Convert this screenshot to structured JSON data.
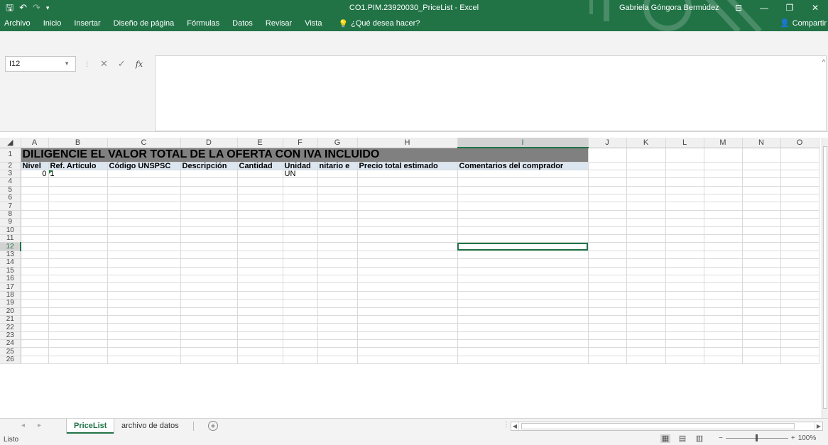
{
  "window": {
    "title": "CO1.PIM.23920030_PriceList - Excel",
    "user": "Gabriela Góngora Bermúdez",
    "controls": [
      "⊟",
      "—",
      "❐",
      "✕"
    ]
  },
  "ribbon": {
    "tabs": [
      "Archivo",
      "Inicio",
      "Insertar",
      "Diseño de página",
      "Fórmulas",
      "Datos",
      "Revisar",
      "Vista"
    ],
    "tell_me": "¿Qué desea hacer?",
    "share": "Compartir"
  },
  "formula_bar": {
    "name_box": "I12",
    "content": ""
  },
  "columns": [
    "A",
    "B",
    "C",
    "D",
    "E",
    "F",
    "G",
    "H",
    "I",
    "J",
    "K",
    "L",
    "M",
    "N",
    "O"
  ],
  "rows": [
    "1",
    "2",
    "3",
    "4",
    "5",
    "6",
    "7",
    "8",
    "9",
    "10",
    "11",
    "12",
    "13",
    "14",
    "15",
    "16",
    "17",
    "18",
    "19",
    "20",
    "21",
    "22",
    "23",
    "24",
    "25",
    "26"
  ],
  "sheet": {
    "title": "DILIGENCIE EL VALOR TOTAL DE LA OFERTA CON IVA INCLUIDO",
    "headers": [
      "Nivel",
      "Ref. Artículo",
      "Código UNSPSC",
      "Descripción",
      "Cantidad",
      "Unidad",
      "nitario e",
      "Precio total estimado",
      "Comentarios del comprador"
    ],
    "row3": {
      "A": "0",
      "B": "1",
      "F": "UN"
    }
  },
  "tabs": {
    "active": "PriceList",
    "other": "archivo de datos"
  },
  "status": {
    "text": "Listo",
    "zoom": "100%"
  }
}
